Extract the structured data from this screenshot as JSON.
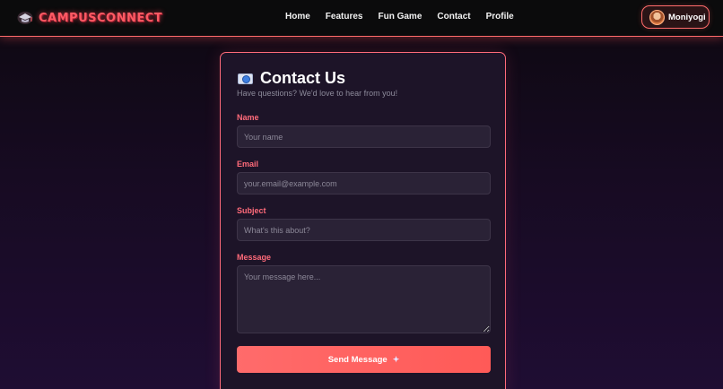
{
  "brand": {
    "name": "CAMPUSCONNECT",
    "color": "#ff5a64"
  },
  "nav": {
    "links": [
      "Home",
      "Features",
      "Fun Game",
      "Contact",
      "Profile"
    ]
  },
  "profile": {
    "username": "Moniyogi",
    "avatar_icon": "user-avatar"
  },
  "contact": {
    "icon": "camera-icon",
    "title": "Contact Us",
    "subtitle": "Have questions? We'd love to hear from you!",
    "fields": {
      "name": {
        "label": "Name",
        "placeholder": "Your name"
      },
      "email": {
        "label": "Email",
        "placeholder": "your.email@example.com"
      },
      "subject": {
        "label": "Subject",
        "placeholder": "What's this about?"
      },
      "message": {
        "label": "Message",
        "placeholder": "Your message here..."
      }
    },
    "submit": {
      "label": "Send Message",
      "icon": "sparkle-icon"
    }
  },
  "colors": {
    "accent": "#ff6b6b",
    "label": "#ff6b7a",
    "card_bg": "#1d1428",
    "input_bg": "#2a2236"
  }
}
